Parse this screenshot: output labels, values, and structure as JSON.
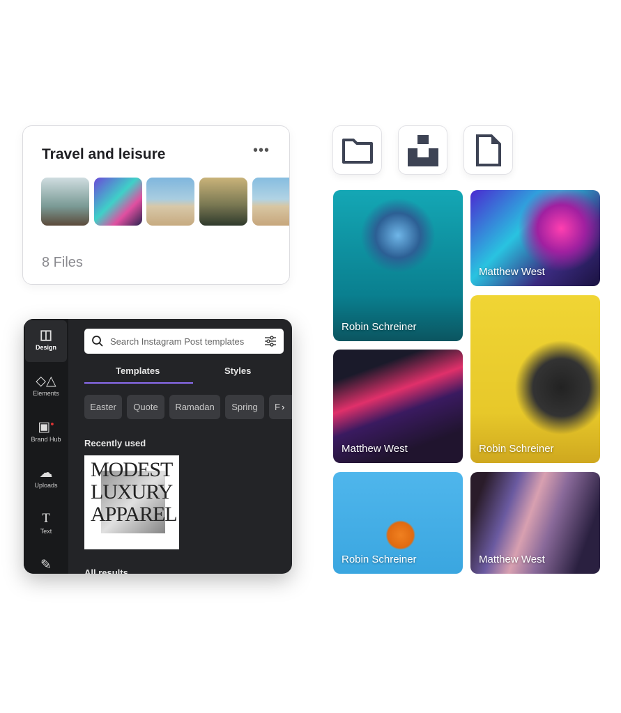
{
  "collection": {
    "title": "Travel and leisure",
    "more_icon": "more-horizontal-icon",
    "files": "8 Files"
  },
  "editor": {
    "sidebar": [
      {
        "label": "Design",
        "icon": "layout-icon"
      },
      {
        "label": "Elements",
        "icon": "shapes-icon"
      },
      {
        "label": "Brand Hub",
        "icon": "brand-icon"
      },
      {
        "label": "Uploads",
        "icon": "cloud-upload-icon"
      },
      {
        "label": "Text",
        "icon": "text-icon"
      }
    ],
    "search_placeholder": "Search Instagram Post templates",
    "tabs": [
      "Templates",
      "Styles"
    ],
    "chips": [
      "Easter",
      "Quote",
      "Ramadan",
      "Spring",
      "F"
    ],
    "recently_used": "Recently used",
    "template_text": [
      "MODEST",
      "LUXURY",
      "APPAREL"
    ],
    "all_results": "All results",
    "accent": "#8b6cf0"
  },
  "quick_icons": [
    "folder-icon",
    "unsplash-icon",
    "file-icon"
  ],
  "photos": [
    {
      "credit": "Robin Schreiner"
    },
    {
      "credit": "Matthew West"
    },
    {
      "credit": "Matthew West"
    },
    {
      "credit": "Robin Schreiner"
    },
    {
      "credit": "Robin Schreiner"
    },
    {
      "credit": "Matthew West"
    }
  ]
}
